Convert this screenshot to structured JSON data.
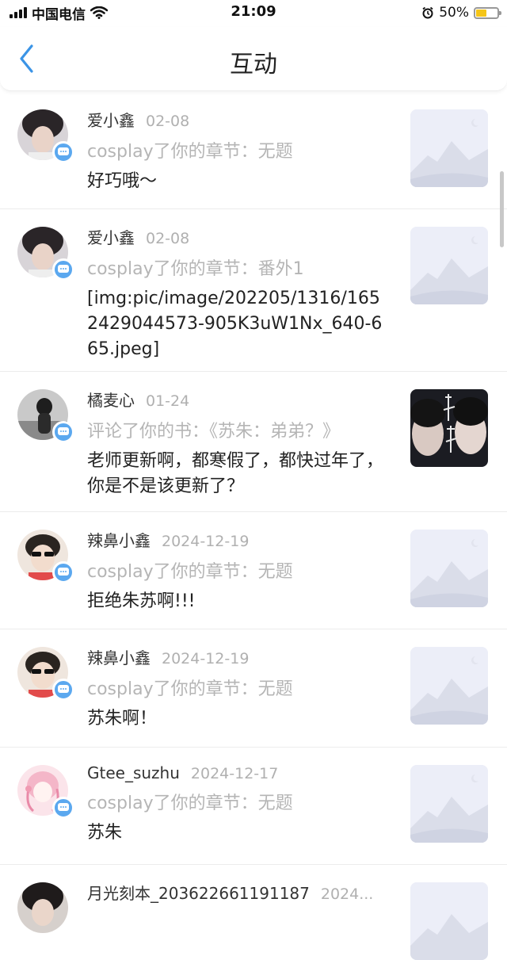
{
  "status_bar": {
    "carrier": "中国电信",
    "time": "21:09",
    "battery_pct": "50%",
    "battery_level": 0.5
  },
  "header": {
    "title": "互动"
  },
  "items": [
    {
      "name": "爱小鑫",
      "date": "02-08",
      "action": "cosplay了你的章节：无题",
      "message": "好巧哦～"
    },
    {
      "name": "爱小鑫",
      "date": "02-08",
      "action": "cosplay了你的章节：番外1",
      "message": "[img:pic/image/202205/1316/1652429044573-905K3uW1Nx_640-665.jpeg]"
    },
    {
      "name": "橘麦心",
      "date": "01-24",
      "action": "评论了你的书：《苏朱：弟弟？》",
      "message": "老师更新啊，都寒假了，都快过年了，你是不是该更新了？"
    },
    {
      "name": "辣鼻小鑫",
      "date": "2024-12-19",
      "action": "cosplay了你的章节：无题",
      "message": "拒绝朱苏啊!!!"
    },
    {
      "name": "辣鼻小鑫",
      "date": "2024-12-19",
      "action": "cosplay了你的章节：无题",
      "message": "苏朱啊！"
    },
    {
      "name": "Gtee_suzhu",
      "date": "2024-12-17",
      "action": "cosplay了你的章节：无题",
      "message": "苏朱"
    },
    {
      "name": "月光刻本_203622661191187",
      "date": "2024...",
      "action": "",
      "message": ""
    }
  ],
  "colors": {
    "accent": "#5ba8ef",
    "muted": "#b5b5b5"
  },
  "icons": {
    "back": "chevron-left-icon",
    "badge": "chat-bubble-icon",
    "wifi": "wifi-icon",
    "alarm": "alarm-icon"
  }
}
